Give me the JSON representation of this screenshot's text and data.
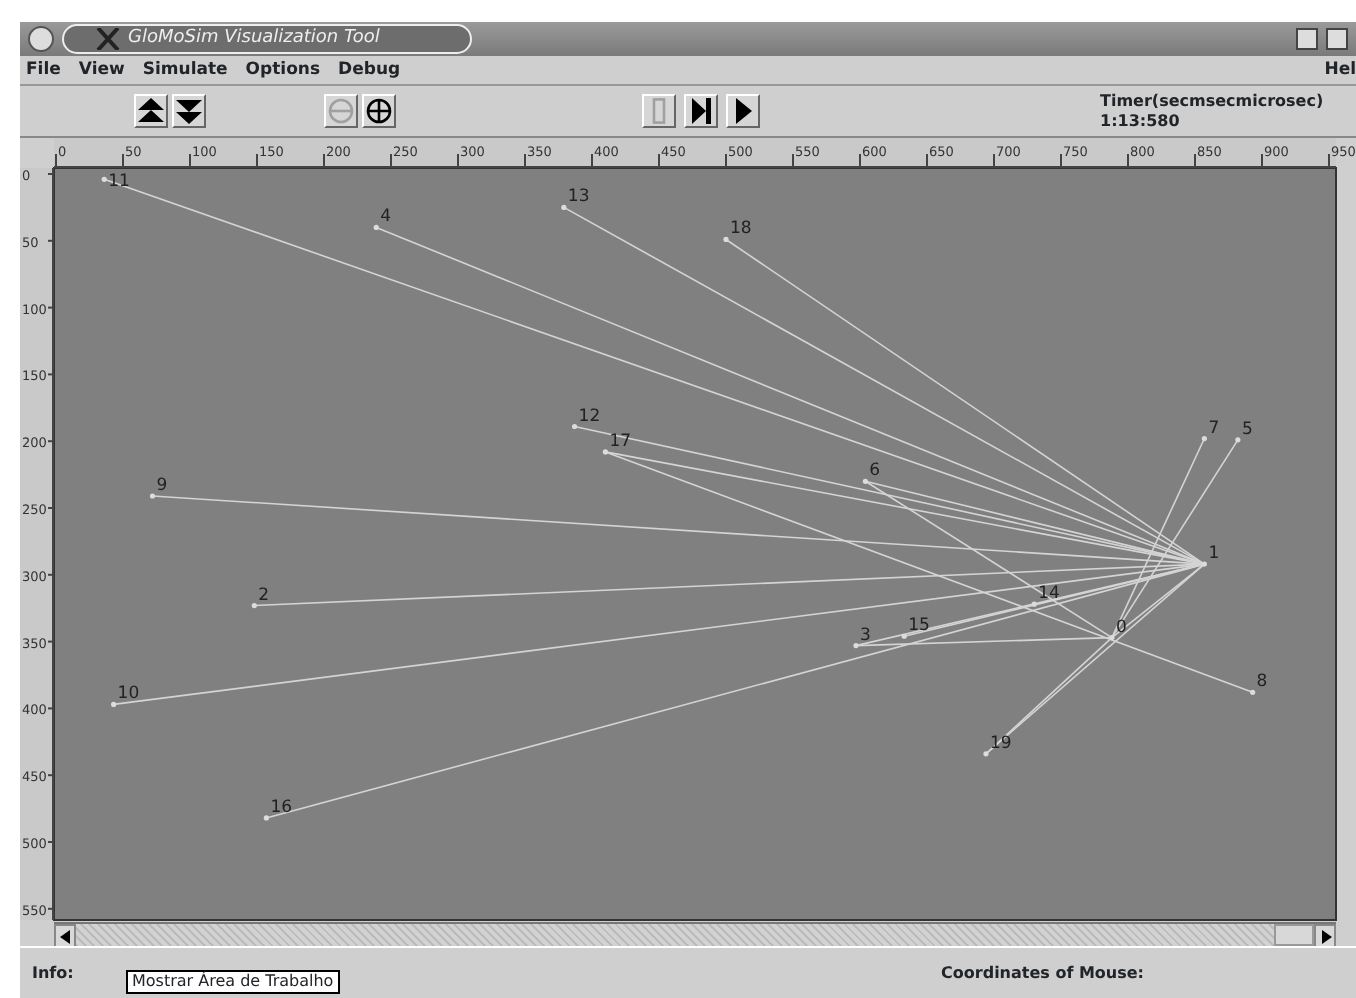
{
  "window": {
    "title": "GloMoSim Visualization Tool"
  },
  "menu": [
    {
      "label": "File"
    },
    {
      "label": "View"
    },
    {
      "label": "Simulate"
    },
    {
      "label": "Options"
    },
    {
      "label": "Debug"
    },
    {
      "label": "Hel"
    }
  ],
  "toolbar": [
    {
      "kind": "up",
      "disabled": false
    },
    {
      "kind": "down",
      "disabled": false
    },
    {
      "kind": "zoom-out",
      "disabled": true
    },
    {
      "kind": "zoom-in",
      "disabled": false
    },
    {
      "kind": "pause",
      "disabled": true
    },
    {
      "kind": "step",
      "disabled": false
    },
    {
      "kind": "play",
      "disabled": false
    }
  ],
  "timer": {
    "label": "Timer(secmsecmicrosec)",
    "value": "1:13:580"
  },
  "rulers": {
    "x_labels": [
      "0",
      "50",
      "100",
      "150",
      "200",
      "250",
      "300",
      "350",
      "400",
      "450",
      "500",
      "550",
      "600",
      "650",
      "700",
      "750",
      "800",
      "850",
      "900",
      "950"
    ],
    "y_labels": [
      "0",
      "50",
      "100",
      "150",
      "200",
      "250",
      "300",
      "350",
      "400",
      "450",
      "500",
      "550"
    ]
  },
  "nodes": [
    {
      "label": "11"
    },
    {
      "label": "4"
    },
    {
      "label": "13"
    },
    {
      "label": "18"
    },
    {
      "label": "12"
    },
    {
      "label": "17"
    },
    {
      "label": "9"
    },
    {
      "label": "2"
    },
    {
      "label": "10"
    },
    {
      "label": "16"
    },
    {
      "label": "6"
    },
    {
      "label": "7"
    },
    {
      "label": "5"
    },
    {
      "label": "1"
    },
    {
      "label": "14"
    },
    {
      "label": "3"
    },
    {
      "label": "15"
    },
    {
      "label": "0"
    },
    {
      "label": "8"
    },
    {
      "label": "19"
    }
  ],
  "status_bar": {
    "info_label": "Info:",
    "tooltip": "Mostrar Área de Trabalho",
    "coordinates_label": "Coordinates of Mouse:"
  }
}
